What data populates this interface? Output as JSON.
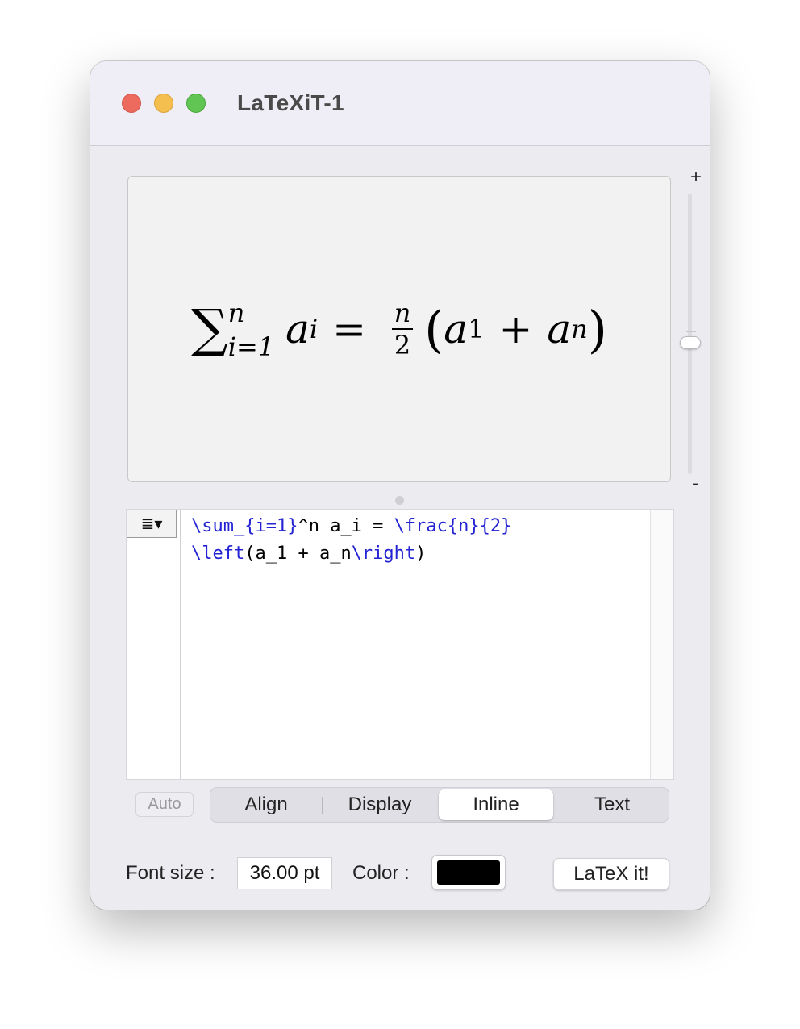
{
  "window": {
    "title": "LaTeXiT-1"
  },
  "preview": {
    "sum_symbol": "∑",
    "sum_upper": "n",
    "sum_lower": "i=1",
    "a": "a",
    "sub_i": "i",
    "equals": "=",
    "frac_num": "n",
    "frac_den": "2",
    "open_paren": "(",
    "sub_1": "1",
    "plus": "+",
    "sub_n": "n",
    "close_paren": ")"
  },
  "zoom": {
    "plus": "+",
    "minus": "-",
    "level": 0.5
  },
  "editor": {
    "menu_icon": "≣▾",
    "line1": [
      {
        "text": "\\sum_{i=1}",
        "kw": true
      },
      {
        "text": "^n a_i = ",
        "kw": false
      },
      {
        "text": "\\frac{n}{2}",
        "kw": true
      }
    ],
    "line2": [
      {
        "text": "\\left",
        "kw": true
      },
      {
        "text": "(a_1 + a_n",
        "kw": false
      },
      {
        "text": "\\right",
        "kw": true
      },
      {
        "text": ")",
        "kw": false
      }
    ]
  },
  "mode": {
    "auto": "Auto",
    "options": [
      "Align",
      "Display",
      "Inline",
      "Text"
    ],
    "selected": "Inline"
  },
  "bottom": {
    "font_size_label": "Font size :",
    "font_size_value": "36.00 pt",
    "color_label": "Color :",
    "color_value": "#000000",
    "latex_button": "LaTeX it!"
  },
  "colors": {
    "keyword": "#2323d3",
    "red_light": "#ed6a5e",
    "yellow_light": "#f5bf4f",
    "green_light": "#61c554"
  }
}
